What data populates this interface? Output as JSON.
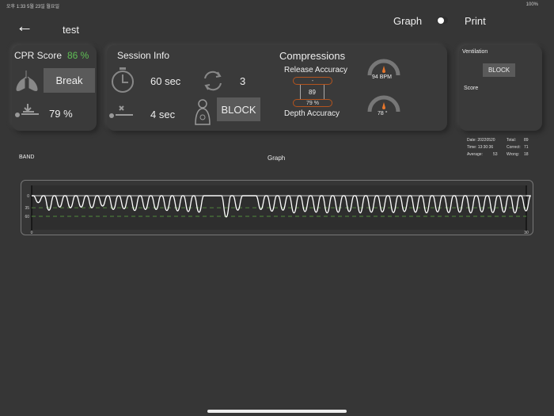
{
  "status_bar": {
    "time": "오후 1:33  5월 23일 월요일",
    "battery": "100%"
  },
  "header": {
    "title": "test",
    "graph_label": "Graph",
    "print_label": "Print"
  },
  "cpr": {
    "title": "CPR Score",
    "score": "86 %",
    "break_label": "Break",
    "depth_value": "79 %"
  },
  "session": {
    "title": "Session Info",
    "duration": "60 sec",
    "cycles": "3",
    "pause": "4 sec",
    "block_label": "BLOCK"
  },
  "compressions": {
    "title": "Compressions",
    "release_label": "Release Accuracy",
    "release_value": "-",
    "count": "89",
    "depth_value": "79 %",
    "depth_label": "Depth Accuracy",
    "rate": "94 BPM",
    "angle": "78 °"
  },
  "ventilation": {
    "title": "Ventilation",
    "block_label": "BLOCK",
    "score_label": "Score"
  },
  "stats": {
    "date": "Date: 20220520",
    "time": "Time:  13:30:36",
    "average_label": "Average:",
    "average": "53",
    "total_label": "Total:",
    "total": "89",
    "correct_label": "Correct:",
    "correct": "71",
    "wrong_label": "Wrong:",
    "wrong": "18"
  },
  "band_label": "BAND",
  "graph_title": "Graph",
  "chart_data": {
    "type": "line",
    "xlim": [
      0,
      30
    ],
    "ylim": [
      0,
      70
    ],
    "y_ticks": [
      "0",
      "35",
      "60"
    ],
    "x_ticks": [
      "0",
      "30"
    ],
    "thresholds": [
      35,
      60
    ],
    "times": [
      0.4,
      1.05,
      1.7,
      2.35,
      3.0,
      3.65,
      4.3,
      4.95,
      5.6,
      6.25,
      6.9,
      7.55,
      8.2,
      8.85,
      9.5,
      10.15,
      11.8,
      12.5,
      13.9,
      14.57,
      15.24,
      15.91,
      16.58,
      17.25,
      17.92,
      18.59,
      19.26,
      19.93,
      20.6,
      21.27,
      21.94,
      22.61,
      23.28,
      23.95,
      24.62,
      25.29,
      25.96,
      26.63,
      27.3,
      27.97,
      28.64,
      29.31,
      29.98
    ],
    "depths": [
      20,
      42,
      33,
      35,
      33,
      35,
      30,
      40,
      38,
      43,
      40,
      40,
      43,
      44,
      46,
      48,
      62,
      42,
      40,
      45,
      42,
      50,
      46,
      48,
      50,
      48,
      46,
      50,
      48,
      47,
      49,
      46,
      48,
      50,
      47,
      49,
      48,
      50,
      47,
      49,
      48,
      50,
      44
    ]
  }
}
